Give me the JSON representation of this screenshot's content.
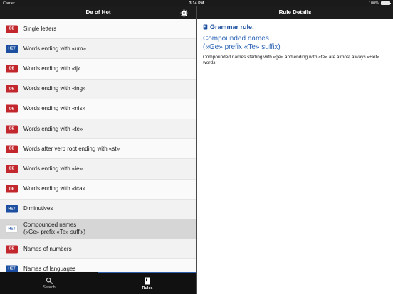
{
  "status": {
    "carrier": "Carrier",
    "time": "3:14 PM",
    "battery": "100%"
  },
  "left_nav": {
    "title": "De of Het"
  },
  "right_nav": {
    "title": "Rule Details"
  },
  "rules": [
    {
      "badge": "DE",
      "type": "de",
      "label": "Single letters"
    },
    {
      "badge": "HET",
      "type": "het",
      "label": "Words ending with «um»"
    },
    {
      "badge": "DE",
      "type": "de",
      "label": "Words ending with «ij»"
    },
    {
      "badge": "DE",
      "type": "de",
      "label": "Words ending with «ing»"
    },
    {
      "badge": "DE",
      "type": "de",
      "label": "Words ending with «nis»"
    },
    {
      "badge": "DE",
      "type": "de",
      "label": "Words ending with «te»"
    },
    {
      "badge": "DE",
      "type": "de",
      "label": "Words after verb root ending with «st»"
    },
    {
      "badge": "DE",
      "type": "de",
      "label": "Words ending with «ie»"
    },
    {
      "badge": "DE",
      "type": "de",
      "label": "Words ending with «ica»"
    },
    {
      "badge": "HET",
      "type": "het",
      "label": "Diminutives"
    },
    {
      "badge": "HET",
      "type": "het-white",
      "label": "Compounded names",
      "label2": "(«Ge» prefix «Te» suffix)",
      "selected": true
    },
    {
      "badge": "DE",
      "type": "de",
      "label": "Names of numbers"
    },
    {
      "badge": "HET",
      "type": "het",
      "label": "Names of languages"
    }
  ],
  "tabs": {
    "search": "Search",
    "rules": "Rules"
  },
  "detail": {
    "header": "Grammar rule:",
    "title_line1": "Compounded names",
    "title_line2": "(«Ge» prefix «Te» suffix)",
    "body": "Compounded names starting with «ge» and ending with «te» are almost always «Het» words."
  },
  "colors": {
    "de": "#c3272e",
    "het": "#1c4fa0",
    "accent": "#2b63b6"
  }
}
